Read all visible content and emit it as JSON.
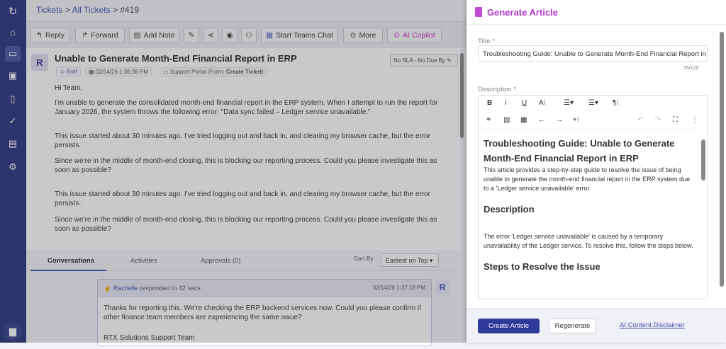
{
  "breadcrumb": {
    "items": [
      "Tickets",
      "All Tickets"
    ],
    "sep": ">",
    "current": "#419"
  },
  "toolbar": {
    "reply": "Reply",
    "forward": "Forward",
    "add_note": "Add Note",
    "teams": "Start Teams Chat",
    "more": "More",
    "ai": "AI Copilot"
  },
  "ticket": {
    "avatar": "R",
    "title": "Unable to Generate Month-End Financial Report in ERP",
    "requester": "Rolf",
    "date": "02/14/26 1:36:36 PM",
    "source": "Support Portal (Form: ",
    "form": "Create Ticket",
    "source_end": ")",
    "sla": "No SLA - No Due By",
    "body": [
      "Hi Team,",
      "I'm unable to generate the consolidated month-end financial report in the ERP system. When I attempt to run the report for January 2026, the system throws the following error: \"Data sync failed – Ledger service unavailable.\"",
      "This issue started about 30 minutes ago. I've tried logging out and back in, and clearing my browser cache, but the error persists.",
      "Since we're in the middle of month-end closing, this is blocking our reporting process. Could you please investigate this as soon as possible?",
      "This issue started about 30 minutes ago. I've tried logging out and back in, and clearing my browser cache, but the error persists .",
      "Since we're in the middle of month-end closing, this is blocking our reporting process. Could you please investigate this as soon as possible?"
    ]
  },
  "tabs": [
    {
      "label": "Conversations"
    },
    {
      "label": "Activities"
    },
    {
      "label": "Approvals (0)"
    }
  ],
  "sort": {
    "label": "Sort By",
    "value": "Earliest on Top"
  },
  "conversation": {
    "agent": "Rachelle",
    "responded": "responded in 42 secs",
    "time": "02/14/26 1:37:18 PM",
    "avatar": "R",
    "text": "Thanks for reporting this. We're checking the ERP backend services now. Could you please confirm if other finance team members are experiencing the same issue?",
    "signature": "RTX Solutions Support Team"
  },
  "panel": {
    "title": "Generate Article",
    "title_label": "Title *",
    "title_value": "Troubleshooting Guide: Unable to Generate Month-End Financial Report in",
    "count": "75/120",
    "desc_label": "Description *",
    "content": {
      "h1": "Troubleshooting Guide: Unable to Generate Month-End Financial Report in ERP",
      "intro": "This article provides a step-by-step guide to resolve the issue of being unable to generate the month-end financial report in the ERP system due to a 'Ledger service unavailable' error.",
      "h2": "Description",
      "desc": "The error 'Ledger service unavailable' is caused by a temporary unavailability of the Ledger service. To resolve this, follow the steps below.",
      "h3": "Steps to Resolve the Issue"
    },
    "create": "Create Article",
    "regenerate": "Regenerate",
    "disclaimer": "AI Content Disclaimer"
  },
  "colors": {
    "sidebar": "#27307a",
    "accent": "#3f4bb0",
    "ai": "#b33cc8",
    "primary_button": "#2e3a99"
  }
}
